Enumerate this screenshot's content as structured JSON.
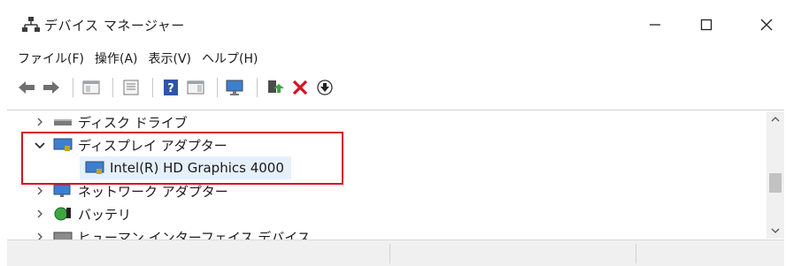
{
  "window": {
    "title": "デバイス マネージャー",
    "icon": "device-manager-icon",
    "controls": {
      "minimize": "minimize-icon",
      "maximize": "maximize-icon",
      "close": "close-icon"
    }
  },
  "menu": [
    {
      "label": "ファイル(F)"
    },
    {
      "label": "操作(A)"
    },
    {
      "label": "表示(V)"
    },
    {
      "label": "ヘルプ(H)"
    }
  ],
  "toolbar": {
    "buttons": [
      "back-arrow-icon",
      "forward-arrow-icon",
      "properties-icon",
      "show-hide-console-tree-icon",
      "help-icon",
      "action-pane-icon",
      "scan-hardware-icon",
      "update-driver-icon",
      "uninstall-icon",
      "disable-device-icon"
    ]
  },
  "tree": {
    "items": [
      {
        "label": "ディスク ドライブ",
        "expanded": false,
        "icon": "disk-drive-icon",
        "level": 0
      },
      {
        "label": "ディスプレイ アダプター",
        "expanded": true,
        "icon": "display-adapter-icon",
        "level": 0
      },
      {
        "label": "Intel(R) HD Graphics 4000",
        "icon": "display-adapter-icon",
        "level": 1,
        "selected": true
      },
      {
        "label": "ネットワーク アダプター",
        "expanded": false,
        "icon": "network-adapter-icon",
        "level": 0
      },
      {
        "label": "バッテリ",
        "expanded": false,
        "icon": "battery-icon",
        "level": 0
      },
      {
        "label": "ヒューマン インターフェイス デバイス",
        "expanded": false,
        "icon": "hid-icon",
        "level": 0
      }
    ]
  },
  "colors": {
    "highlight_border": "#d6121e",
    "selection": "#e6f0fb",
    "uninstall_red": "#d6121e"
  }
}
